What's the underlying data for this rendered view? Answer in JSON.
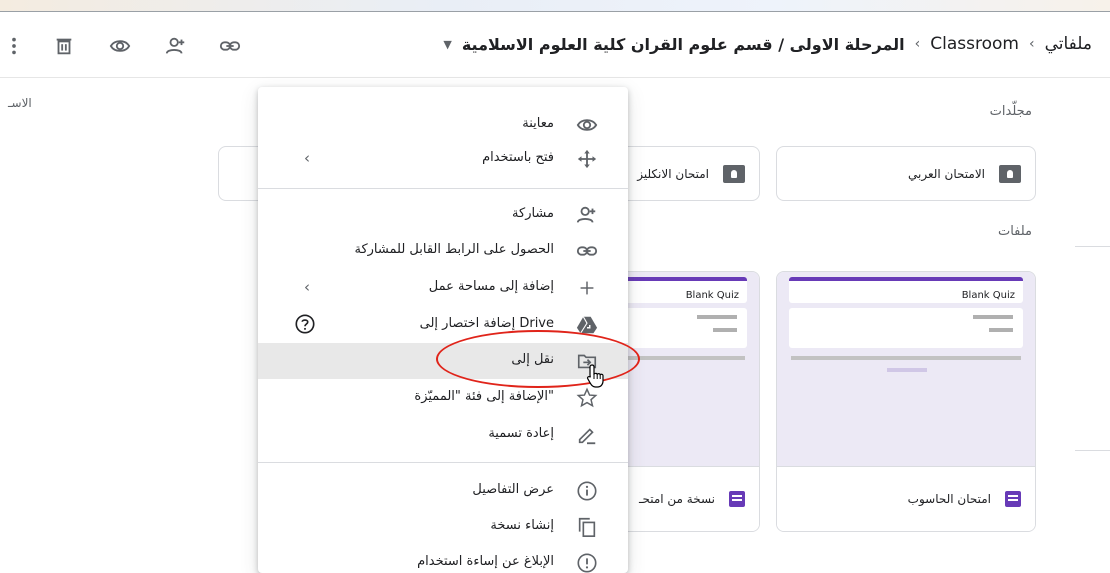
{
  "toolbar": {
    "breadcrumb": {
      "root": "ملفاتي",
      "middle": "Classroom",
      "current": "المرحلة الاولى / قسم علوم القران كلية العلوم الاسلامية",
      "dropdown_glyph": "▼",
      "separator_glyph": "‹"
    },
    "icons": [
      "more-vert-icon",
      "trash-icon",
      "eye-icon",
      "add-person-icon",
      "link-icon"
    ]
  },
  "left_cut_label": "الاسـ",
  "folders_section": {
    "label": "مجلّدات",
    "items": [
      {
        "name": "الامتحان العربي"
      },
      {
        "name": "امتحان الانكليز"
      }
    ]
  },
  "files_section": {
    "label": "ملفات",
    "items": [
      {
        "name": "امتحان الحاسوب",
        "thumb_title": "Blank Quiz"
      },
      {
        "name": "نسخة من امتحـ",
        "thumb_title": "Blank Quiz"
      }
    ]
  },
  "context_menu": {
    "items": [
      {
        "label": "معاينة",
        "icon": "eye-icon"
      },
      {
        "label": "فتح باستخدام",
        "icon": "open-with-icon",
        "submenu_glyph": "‹"
      },
      {
        "label": "مشاركة",
        "icon": "add-person-icon"
      },
      {
        "label": "الحصول على الرابط القابل للمشاركة",
        "icon": "link-icon"
      },
      {
        "label": "إضافة إلى مساحة عمل",
        "icon": "plus-icon",
        "submenu_glyph": "‹"
      },
      {
        "label": "إضافة اختصار إلى Drive",
        "icon": "drive-shortcut-icon",
        "help_icon": "help-icon"
      },
      {
        "label": "نقل إلى",
        "icon": "move-to-icon",
        "hovered": true
      },
      {
        "label": "الإضافة إلى فئة \"المميّزة\"",
        "icon": "star-icon"
      },
      {
        "label": "إعادة تسمية",
        "icon": "pencil-icon"
      },
      {
        "label": "عرض التفاصيل",
        "icon": "info-icon"
      },
      {
        "label": "إنشاء نسخة",
        "icon": "copy-icon"
      },
      {
        "label": "الإبلاغ عن إساءة استخدام",
        "icon": "report-icon"
      }
    ]
  },
  "colors": {
    "accent_purple": "#673ab7",
    "annotation_red": "#e0241a",
    "hover_gray": "#e8e8e8"
  }
}
